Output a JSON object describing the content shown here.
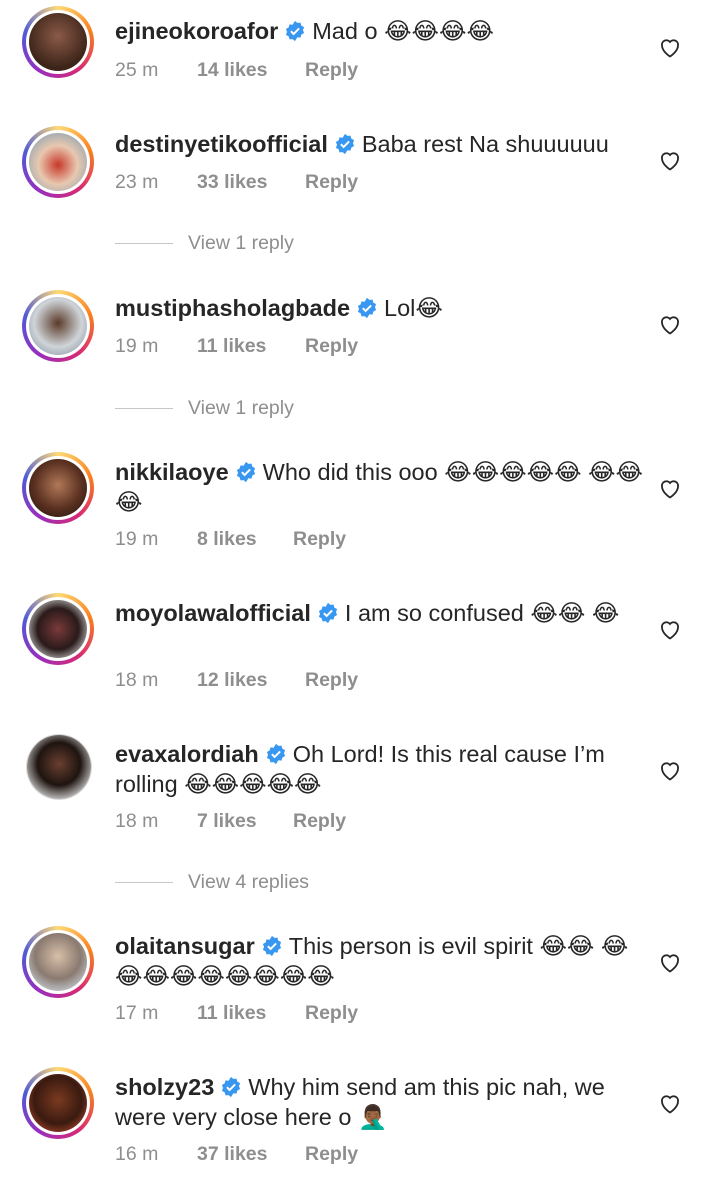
{
  "comments": [
    {
      "username": "ejineokoroafor",
      "text": "Mad o 😂😂😂😂",
      "time": "25 m",
      "likes": "14 likes",
      "reply": "Reply",
      "ring": true,
      "avatar_color": "#5a3a2c"
    },
    {
      "username": "destinyetikoofficial",
      "text": "Baba rest Na shuuuuuu",
      "time": "23 m",
      "likes": "33 likes",
      "reply": "Reply",
      "ring": true,
      "avatar_color": "#b03a2e",
      "view_replies": "View 1 reply"
    },
    {
      "username": "mustiphasholagbade",
      "text": "Lol😂",
      "time": "19 m",
      "likes": "11 likes",
      "reply": "Reply",
      "ring": true,
      "avatar_color": "#6e7f8d",
      "view_replies": "View 1 reply"
    },
    {
      "username": "nikkilaoye",
      "text": "Who did this ooo 😂😂😂😂😂 😂😂😂",
      "time": "19 m",
      "likes": "8 likes",
      "reply": "Reply",
      "ring": true,
      "avatar_color": "#7a4a3a"
    },
    {
      "username": "moyolawalofficial",
      "text": "I am so confused 😂😂 😂",
      "time": "18 m",
      "likes": "12 likes",
      "reply": "Reply",
      "ring": true,
      "avatar_color": "#3a2a2a"
    },
    {
      "username": "evaxalordiah",
      "text": "Oh Lord! Is this real cause I’m rolling 😂😂😂😂😂",
      "time": "18 m",
      "likes": "7 likes",
      "reply": "Reply",
      "ring": false,
      "avatar_color": "#a8a8a8",
      "view_replies": "View 4 replies"
    },
    {
      "username": "olaitansugar",
      "text": "This person is evil spirit 😂😂 😂😂😂😂😂😂😂😂😂",
      "time": "17 m",
      "likes": "11 likes",
      "reply": "Reply",
      "ring": true,
      "avatar_color": "#b8a8a0"
    },
    {
      "username": "sholzy23",
      "text": "Why him send am this pic nah, we were very close here o 🤦🏾‍♂️",
      "time": "16 m",
      "likes": "37 likes",
      "reply": "Reply",
      "ring": true,
      "avatar_color": "#6a2a1a"
    }
  ]
}
